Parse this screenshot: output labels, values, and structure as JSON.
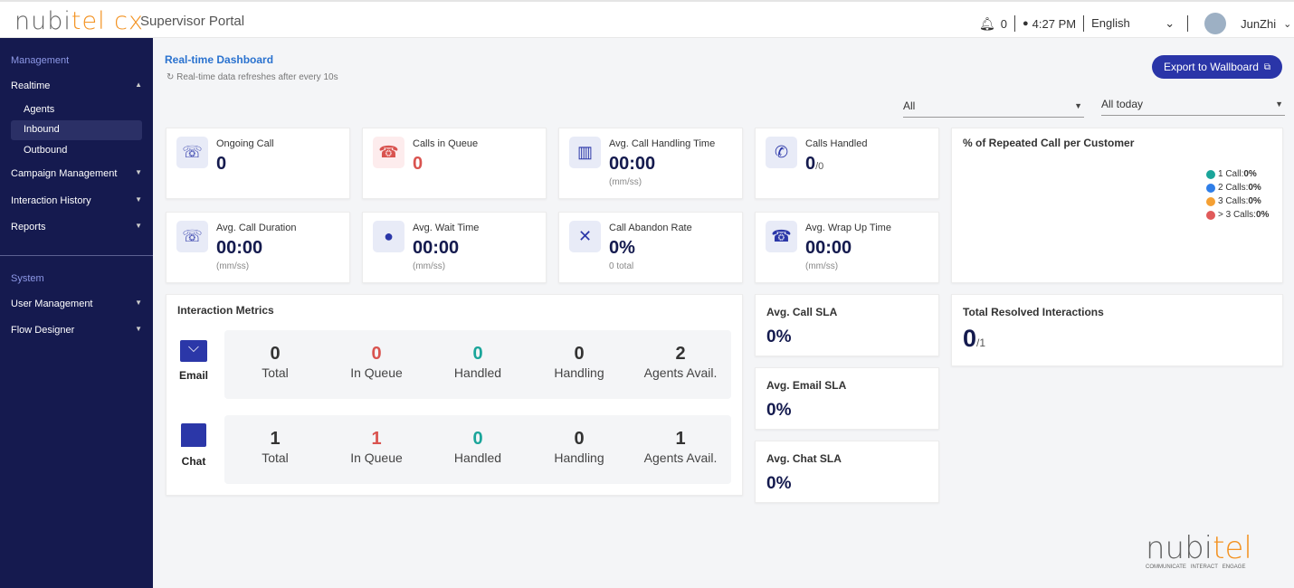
{
  "header": {
    "logo_text": "nubitel cx",
    "portal_title": "Supervisor Portal",
    "notifications": "0",
    "time": "4:27 PM",
    "language": "English",
    "user": "JunZhi"
  },
  "sidebar": {
    "management": "Management",
    "realtime": "Realtime",
    "agents": "Agents",
    "inbound": "Inbound",
    "outbound": "Outbound",
    "campaign": "Campaign Management",
    "history": "Interaction History",
    "reports": "Reports",
    "system": "System",
    "user_mgmt": "User Management",
    "flow": "Flow Designer"
  },
  "page": {
    "title": "Real-time Dashboard",
    "refresh_note": "Real-time data refreshes after every 10s",
    "export_label": "Export to Wallboard",
    "filter1": "All",
    "filter2": "All today"
  },
  "cards": [
    {
      "label": "Ongoing Call",
      "value": "0",
      "icon": "phone-ringing-icon"
    },
    {
      "label": "Calls in Queue",
      "value": "0",
      "icon": "phone-hangup-icon"
    },
    {
      "label": "Avg. Call Handling Time",
      "value": "00:00",
      "sub": "(mm/ss)",
      "icon": "call-stats-icon"
    },
    {
      "label": "Calls Handled",
      "value": "0",
      "suffix": "/0",
      "icon": "phone-check-icon"
    },
    {
      "label": "Avg. Call Duration",
      "value": "00:00",
      "sub": "(mm/ss)",
      "icon": "phone-clock-icon"
    },
    {
      "label": "Avg. Wait Time",
      "value": "00:00",
      "sub": "(mm/ss)",
      "icon": "user-clock-icon"
    },
    {
      "label": "Call Abandon Rate",
      "value": "0%",
      "sub": "0 total",
      "icon": "phone-x-icon"
    },
    {
      "label": "Avg. Wrap Up Time",
      "value": "00:00",
      "sub": "(mm/ss)",
      "icon": "phone-hand-icon"
    }
  ],
  "repeated": {
    "title": "% of Repeated Call per Customer",
    "legend": [
      {
        "label": "1 Call: ",
        "value": "0%",
        "color": "#1aa59a"
      },
      {
        "label": "2 Calls: ",
        "value": "0%",
        "color": "#2f7ee8"
      },
      {
        "label": "3 Calls: ",
        "value": "0%",
        "color": "#f5a033"
      },
      {
        "label": "> 3 Calls: ",
        "value": "0%",
        "color": "#e05a5a"
      }
    ]
  },
  "interaction": {
    "title": "Interaction Metrics",
    "labels": [
      "Total",
      "In Queue",
      "Handled",
      "Handling",
      "Agents Avail."
    ],
    "email": {
      "name": "Email",
      "values": [
        "0",
        "0",
        "0",
        "0",
        "2"
      ]
    },
    "chat": {
      "name": "Chat",
      "values": [
        "1",
        "1",
        "0",
        "0",
        "1"
      ]
    }
  },
  "sla": [
    {
      "label": "Avg. Call SLA",
      "value": "0%"
    },
    {
      "label": "Avg. Email SLA",
      "value": "0%"
    },
    {
      "label": "Avg. Chat SLA",
      "value": "0%"
    }
  ],
  "resolved": {
    "title": "Total Resolved Interactions",
    "value": "0",
    "suffix": "/1"
  },
  "footer_logo": {
    "text": "nubitel",
    "tagline": "COMMUNICATE   INTERACT   ENGAGE"
  }
}
